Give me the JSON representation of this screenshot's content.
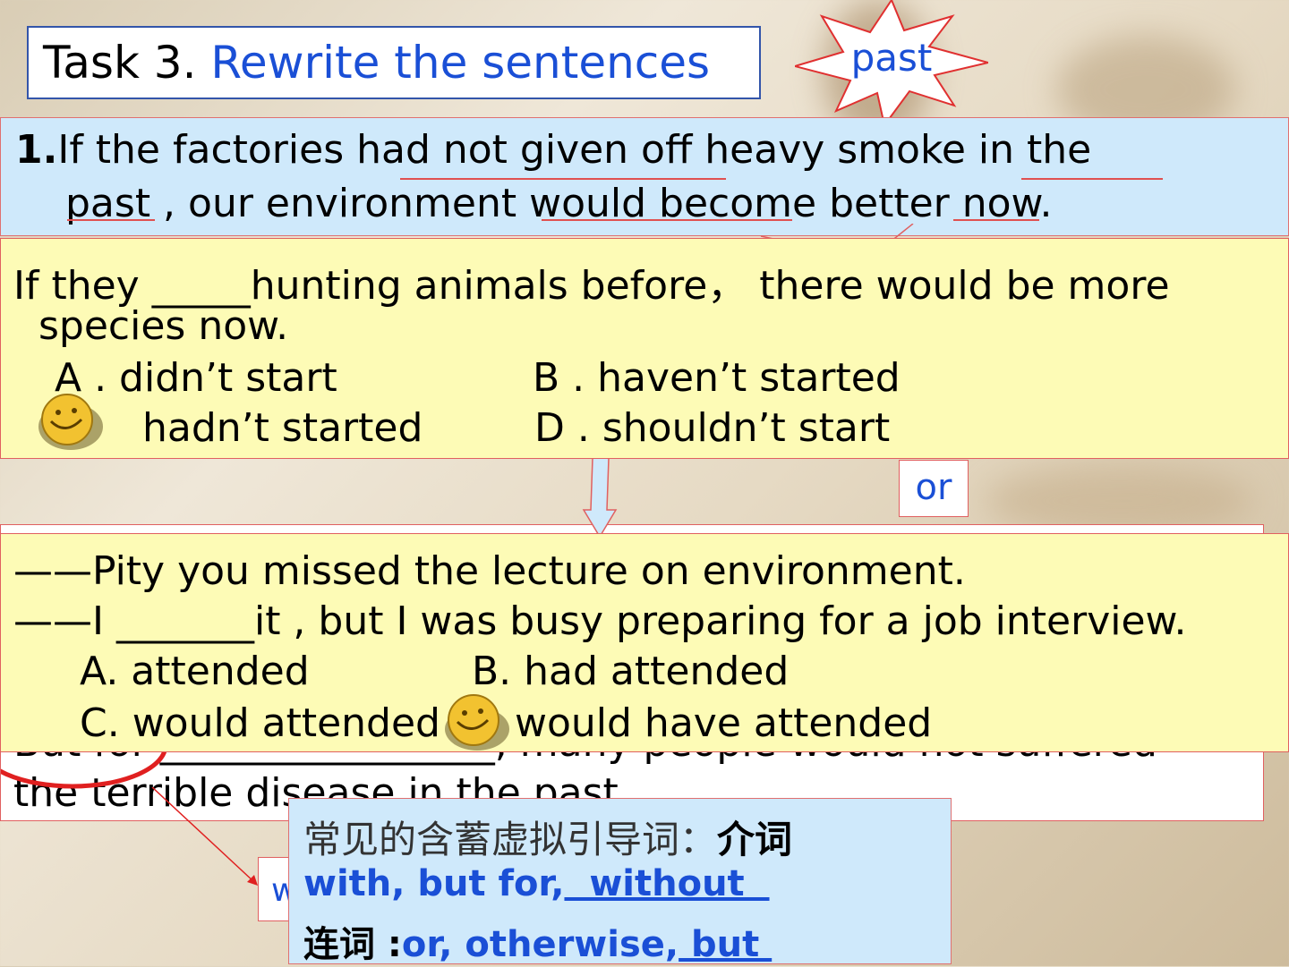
{
  "title": {
    "task": "Task 3.",
    "subtitle": "Rewrite the sentences"
  },
  "star_label": "past",
  "q1": {
    "line1_num": "1.",
    "line1_text": "If the factories had not given off heavy smoke in the",
    "line2_text": "past , our environment would become better now."
  },
  "mc1": {
    "question_line1": "If they _____hunting animals before，  there would be more",
    "question_line2": "species now.",
    "option_a": "A .   didn’t start",
    "option_b": "B .   haven’t started",
    "option_c": "hadn’t started",
    "option_d": "D .   shouldn’t start"
  },
  "or_label": "or",
  "mc2": {
    "line1": "——Pity you missed the lecture on environment.",
    "line2": "——I _______it , but I was busy preparing for a job interview.",
    "option_a": "A. attended",
    "option_b": "B. had attended",
    "option_c": "C. would attended",
    "option_d": "would have attended"
  },
  "behind": {
    "line1_partial": "But for  _________________, many people would not suffered",
    "line2_partial": "the terrible disease in the past."
  },
  "w_label": "w",
  "note": {
    "heading": "常见的含蓄虚拟引导词：",
    "heading_bold": "介词",
    "prep_list": "with, but for,",
    "prep_answer": "  without  ",
    "conj_label": "连词 :",
    "conj_list": "or, otherwise,",
    "conj_answer": " but "
  },
  "colors": {
    "blue_text": "#1a4fd6",
    "answer_blue": "#1a4fd6",
    "red_border": "#e06060"
  }
}
